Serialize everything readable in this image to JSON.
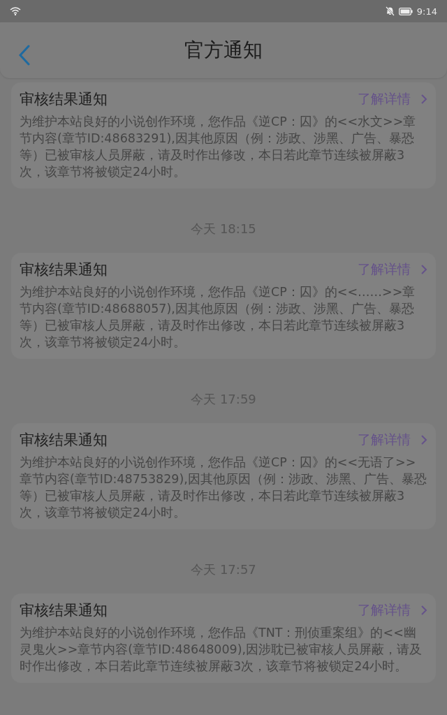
{
  "status_bar": {
    "time": "9:14"
  },
  "header": {
    "title": "官方通知"
  },
  "notifications": [
    {
      "title": "审核结果通知",
      "link": "了解详情",
      "body": "为维护本站良好的小说创作环境，您作品《逆CP：囚》的<<水文>>章节内容(章节ID:48683291),因其他原因（例：涉政、涉黑、广告、暴恐等）已被审核人员屏蔽，请及时作出修改，本日若此章节连续被屏蔽3次，该章节将被锁定24小时。"
    },
    {
      "time": "今天 18:15",
      "title": "审核结果通知",
      "link": "了解详情",
      "body": "为维护本站良好的小说创作环境，您作品《逆CP：囚》的<<……>>章节内容(章节ID:48688057),因其他原因（例：涉政、涉黑、广告、暴恐等）已被审核人员屏蔽，请及时作出修改，本日若此章节连续被屏蔽3次，该章节将被锁定24小时。"
    },
    {
      "time": "今天 17:59",
      "title": "审核结果通知",
      "link": "了解详情",
      "body": "为维护本站良好的小说创作环境，您作品《逆CP：囚》的<<无语了>>章节内容(章节ID:48753829),因其他原因（例：涉政、涉黑、广告、暴恐等）已被审核人员屏蔽，请及时作出修改，本日若此章节连续被屏蔽3次，该章节将被锁定24小时。"
    },
    {
      "time": "今天 17:57",
      "title": "审核结果通知",
      "link": "了解详情",
      "body": "为维护本站良好的小说创作环境，您作品《TNT：刑侦重案组》的<<幽灵鬼火>>章节内容(章节ID:48648009),因涉耽已被审核人员屏蔽，请及时作出修改，本日若此章节连续被屏蔽3次，该章节将被锁定24小时。"
    }
  ]
}
